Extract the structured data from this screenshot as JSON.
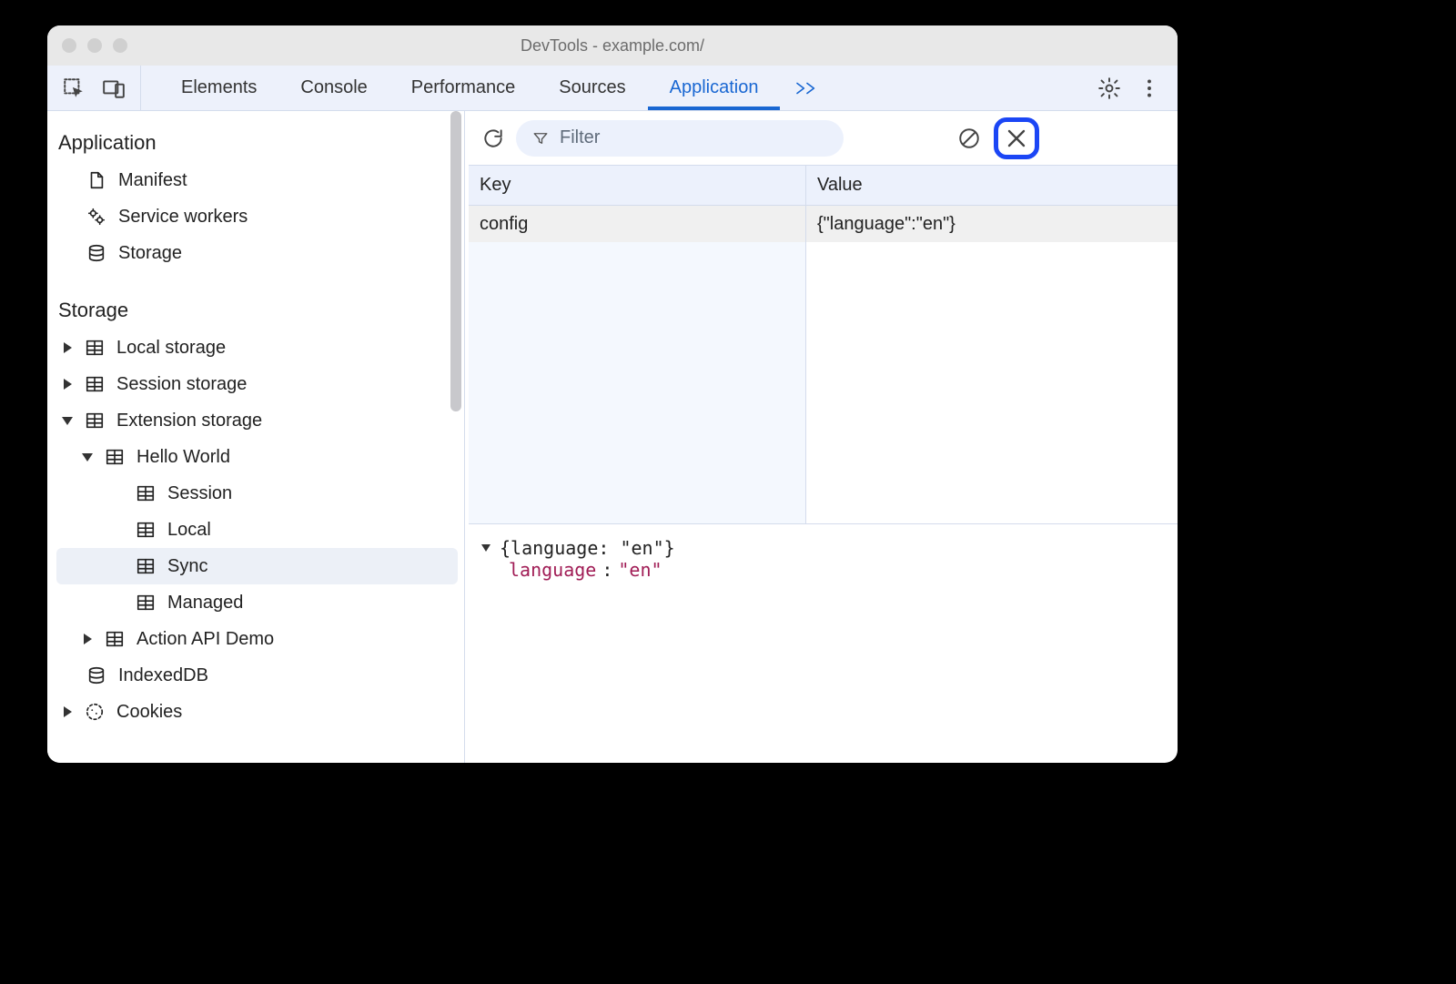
{
  "window": {
    "title": "DevTools - example.com/"
  },
  "tabs": {
    "items": [
      "Elements",
      "Console",
      "Performance",
      "Sources",
      "Application"
    ],
    "active": "Application"
  },
  "toolbar": {
    "filter_placeholder": "Filter"
  },
  "sidebar": {
    "sections": {
      "application": {
        "title": "Application",
        "items": [
          "Manifest",
          "Service workers",
          "Storage"
        ]
      },
      "storage": {
        "title": "Storage",
        "local_storage": "Local storage",
        "session_storage": "Session storage",
        "extension_storage": "Extension storage",
        "ext_children": {
          "hello_world": "Hello World",
          "hw_children": [
            "Session",
            "Local",
            "Sync",
            "Managed"
          ],
          "action_api_demo": "Action API Demo"
        },
        "indexeddb": "IndexedDB",
        "cookies": "Cookies"
      }
    }
  },
  "table": {
    "headers": {
      "key": "Key",
      "value": "Value"
    },
    "rows": [
      {
        "key": "config",
        "value": "{\"language\":\"en\"}"
      }
    ]
  },
  "inspector": {
    "summary": "{language: \"en\"}",
    "prop": "language",
    "sep": ": ",
    "val": "\"en\""
  }
}
